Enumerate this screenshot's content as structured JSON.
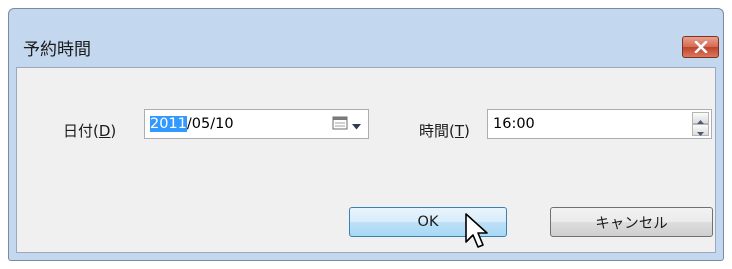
{
  "window": {
    "title": "予約時間"
  },
  "date": {
    "label_main": "日付(",
    "label_key": "D",
    "label_end": ")",
    "value_selected": "2011",
    "value_rest": "/05/10"
  },
  "time": {
    "label_main": "時間(",
    "label_key": "T",
    "label_end": ")",
    "value": "16:00"
  },
  "buttons": {
    "ok": "OK",
    "cancel": "キャンセル"
  },
  "icons": {
    "close": "close-icon",
    "calendar": "calendar-icon",
    "cursor": "mouse-pointer-icon"
  },
  "colors": {
    "selection": "#3399ff",
    "close_button": "#c75a43",
    "ok_border": "#3c7fb1"
  }
}
